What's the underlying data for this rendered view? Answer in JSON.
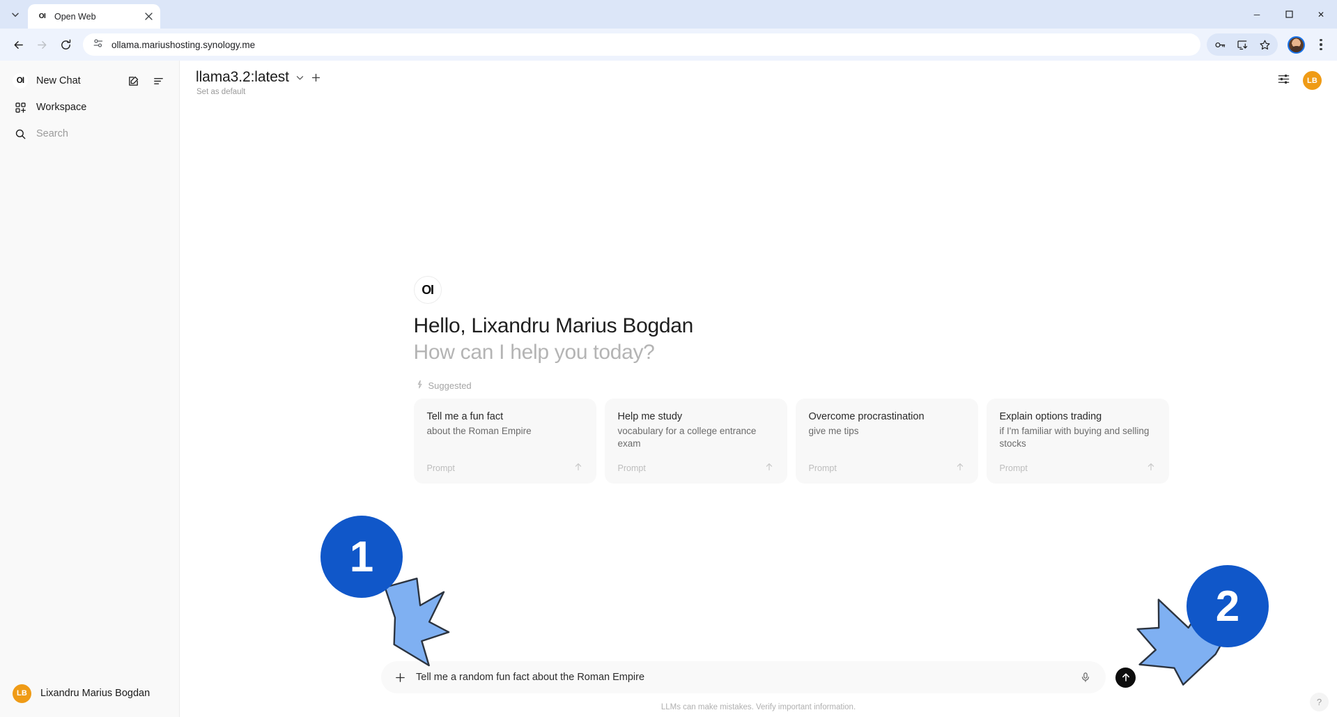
{
  "browser": {
    "tab": {
      "title": "Open Web",
      "favicon_text": "OI",
      "close_icon": "close-icon"
    },
    "tabstrip_chevron_icon": "chevron-down-icon",
    "nav": {
      "back": "back-arrow-icon",
      "forward": "forward-arrow-icon",
      "reload": "reload-icon"
    },
    "omnibox": {
      "url": "ollama.mariushosting.synology.me",
      "site_info_icon": "site-settings-icon"
    },
    "toolbar_icons": [
      "password-key-icon",
      "install-app-icon",
      "bookmark-star-icon"
    ],
    "menu_icon": "three-dot-menu-icon",
    "window_controls": {
      "minimize": "─",
      "maximize": "❐",
      "close": "✕"
    }
  },
  "sidebar": {
    "new_chat": {
      "label": "New Chat",
      "logo_text": "OI",
      "edit_icon": "new-chat-edit-icon",
      "toggle_icon": "sidebar-toggle-icon"
    },
    "workspace": {
      "label": "Workspace",
      "icon": "workspace-grid-icon"
    },
    "search": {
      "placeholder": "Search",
      "icon": "search-icon"
    },
    "user": {
      "name": "Lixandru Marius Bogdan",
      "initials": "LB"
    }
  },
  "header": {
    "model": "llama3.2:latest",
    "set_as_default": "Set as default",
    "chevron_icon": "chevron-down-icon",
    "add_model_icon": "plus-icon",
    "controls_icon": "sliders-controls-icon",
    "user_initials": "LB"
  },
  "welcome": {
    "brand_text": "OI",
    "greeting": "Hello, Lixandru Marius Bogdan",
    "question": "How can I help you today?",
    "suggested_label": "Suggested",
    "suggested_icon": "sparkle-icon"
  },
  "cards": [
    {
      "title": "Tell me a fun fact",
      "subtitle": "about the Roman Empire",
      "footer": "Prompt",
      "arrow_icon": "arrow-up-icon"
    },
    {
      "title": "Help me study",
      "subtitle": "vocabulary for a college entrance exam",
      "footer": "Prompt",
      "arrow_icon": "arrow-up-icon"
    },
    {
      "title": "Overcome procrastination",
      "subtitle": "give me tips",
      "footer": "Prompt",
      "arrow_icon": "arrow-up-icon"
    },
    {
      "title": "Explain options trading",
      "subtitle": "if I'm familiar with buying and selling stocks",
      "footer": "Prompt",
      "arrow_icon": "arrow-up-icon"
    }
  ],
  "composer": {
    "value": "Tell me a random fun fact about the Roman Empire",
    "plus_icon": "attach-plus-icon",
    "mic_icon": "microphone-icon",
    "send_icon": "send-arrow-up-icon"
  },
  "footer_note": "LLMs can make mistakes. Verify important information.",
  "help_button": "?",
  "annotations": [
    {
      "number": "1",
      "target": "message-input"
    },
    {
      "number": "2",
      "target": "send-button"
    }
  ],
  "colors": {
    "badge_blue": "#1057c9",
    "arrow_blue": "#7fb0f2",
    "avatar_orange": "#ef9b16",
    "send_black": "#0d0d0d"
  }
}
